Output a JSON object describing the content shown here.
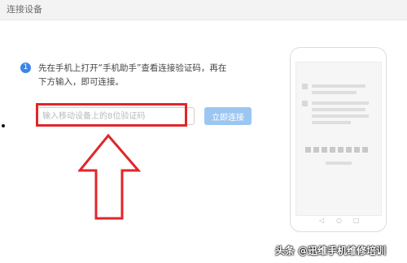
{
  "window": {
    "title": "连接设备"
  },
  "step": {
    "number": "1",
    "line1": "先在手机上打开“手机助手”查看连接验证码，再在",
    "line2": "下方输入，即可连接。"
  },
  "code_input": {
    "placeholder": "输入移动设备上的8位验证码",
    "value": ""
  },
  "connect_button": {
    "label": "立即连接"
  },
  "phone_nav": {
    "back": "◁",
    "home": "○",
    "recent": "□"
  },
  "watermark": {
    "text": "头条 @迅维手机维修培训"
  },
  "colors": {
    "accent": "#3a86e8",
    "button": "#9cc6f2",
    "highlight": "#e0262a"
  }
}
